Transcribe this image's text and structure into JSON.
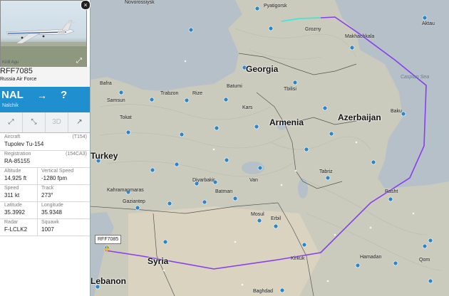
{
  "map": {
    "countries": [
      "Georgia",
      "Armenia",
      "Azerbaijan",
      "Syria",
      "Turkey",
      "Lebanon"
    ],
    "cities": [
      "Novorossiysk",
      "Pyatigorsk",
      "Grozny",
      "Makhachkala",
      "Aktau",
      "Batumi",
      "Tbilisi",
      "Samsun",
      "Rize",
      "Trabzon",
      "Bafra",
      "Tokat",
      "Kars",
      "Baku",
      "Tabriz",
      "Diyarbakir",
      "Batman",
      "Van",
      "Gaziantep",
      "Kahramanmaras",
      "Mosul",
      "Erbil",
      "Rasht",
      "Hamadan",
      "Baghdad",
      "Qom",
      "Kirkuk"
    ],
    "seas": [
      "Caspian Sea"
    ],
    "flight_tag": "RFF7085"
  },
  "panel": {
    "close": "×",
    "photo_copyright": "Kirill Agu",
    "callsign": "RFF7085",
    "airline": "Russia Air Force",
    "origin_code": "NAL",
    "arrow": "→",
    "destination_code": "?",
    "origin_name": "Nalchik",
    "actions": [
      "⤢",
      "⤡",
      "3D",
      "↗"
    ],
    "aircraft": {
      "label": "Aircraft",
      "code": "(T154)",
      "value": "Tupolev Tu-154"
    },
    "registration": {
      "label": "Registration",
      "code": "(154CA3)",
      "value": "RA-85155"
    },
    "altitude": {
      "label": "Altitude",
      "value": "14,925 ft"
    },
    "vertical_speed": {
      "label": "Vertical Speed",
      "value": "-1280 fpm"
    },
    "speed": {
      "label": "Speed",
      "value": "311 kt"
    },
    "track": {
      "label": "Track",
      "value": "273°"
    },
    "latitude": {
      "label": "Latitude",
      "value": "35.3992"
    },
    "longitude": {
      "label": "Longitude",
      "value": "35.9348"
    },
    "radar": {
      "label": "Radar",
      "value": "F-LCLK2"
    },
    "squawk": {
      "label": "Squawk",
      "value": "1007"
    }
  },
  "colors": {
    "route_path": "#8a3cf0",
    "route_recent": "#3ce8d8",
    "header_blue": "#1f8fd0",
    "sea": "#b9c2c9",
    "land": "#cfcfc3"
  }
}
